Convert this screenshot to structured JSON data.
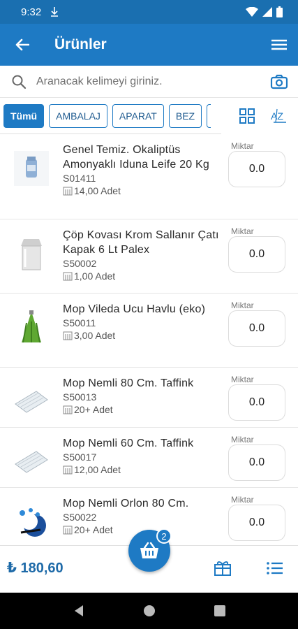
{
  "status": {
    "time": "9:32"
  },
  "header": {
    "title": "Ürünler"
  },
  "search": {
    "placeholder": "Aranacak kelimeyi giriniz."
  },
  "filters": {
    "chips": [
      "Tümü",
      "AMBALAJ",
      "APARAT",
      "BEZ"
    ],
    "sort_label": "AZ"
  },
  "products": [
    {
      "name": "Genel Temiz. Okaliptüs Amonyaklı Iduna Leife 20 Kg",
      "code": "S01411",
      "stock": "14,00 Adet",
      "qty_label": "Miktar",
      "qty": "0.0"
    },
    {
      "name": "Çöp Kovası Krom Sallanır Çatı Kapak  6 Lt Palex",
      "code": "S50002",
      "stock": "1,00 Adet",
      "qty_label": "Miktar",
      "qty": "0.0"
    },
    {
      "name": "Mop Vileda Ucu Havlu (eko)",
      "code": "S50011",
      "stock": "3,00 Adet",
      "qty_label": "Miktar",
      "qty": "0.0"
    },
    {
      "name": "Mop Nemli 80 Cm. Taffink",
      "code": "S50013",
      "stock": "20+ Adet",
      "qty_label": "Miktar",
      "qty": "0.0"
    },
    {
      "name": "Mop Nemli 60 Cm.  Taffink",
      "code": "S50017",
      "stock": "12,00 Adet",
      "qty_label": "Miktar",
      "qty": "0.0"
    },
    {
      "name": "Mop Nemli Orlon  80 Cm.",
      "code": "S50022",
      "stock": "20+ Adet",
      "qty_label": "Miktar",
      "qty": "0.0"
    }
  ],
  "cart": {
    "total": "₺ 180,60",
    "count": "2"
  },
  "colors": {
    "primary": "#1e7ac4",
    "status_bar": "#1a6fb0",
    "text_accent": "#1e6aa8"
  }
}
